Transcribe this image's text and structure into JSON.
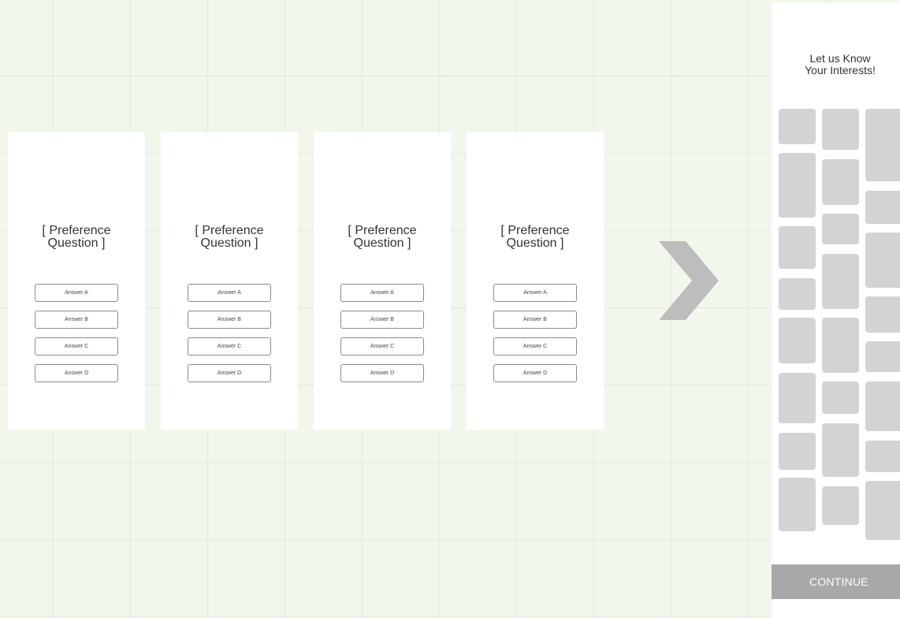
{
  "question_cards": [
    {
      "title": "[ Preference\nQuestion ]",
      "answers": [
        "Answer A",
        "Answer B",
        "Answer C",
        "Answer D"
      ]
    },
    {
      "title": "[ Preference\nQuestion ]",
      "answers": [
        "Answer A",
        "Answer B",
        "Answer C",
        "Answer D"
      ]
    },
    {
      "title": "[ Preference\nQuestion ]",
      "answers": [
        "Answer A",
        "Answer B",
        "Answer C",
        "Answer D"
      ]
    },
    {
      "title": "[ Preference\nQuestion ]",
      "answers": [
        "Answer A",
        "Answer B",
        "Answer C",
        "Answer D"
      ]
    }
  ],
  "next_arrow": {
    "icon": "chevron-right-icon"
  },
  "interests_screen": {
    "title": "Let us Know\nYour Interests!",
    "continue_label": "CONTINUE"
  },
  "colors": {
    "canvas_background": "#f2f7ec",
    "grid_line": "#e3e8e1",
    "card_background": "#ffffff",
    "tile_placeholder": "#d3d3d3",
    "arrow": "#bdbdbd",
    "continue_button": "#a8a8a8",
    "continue_text": "#ffffff"
  }
}
